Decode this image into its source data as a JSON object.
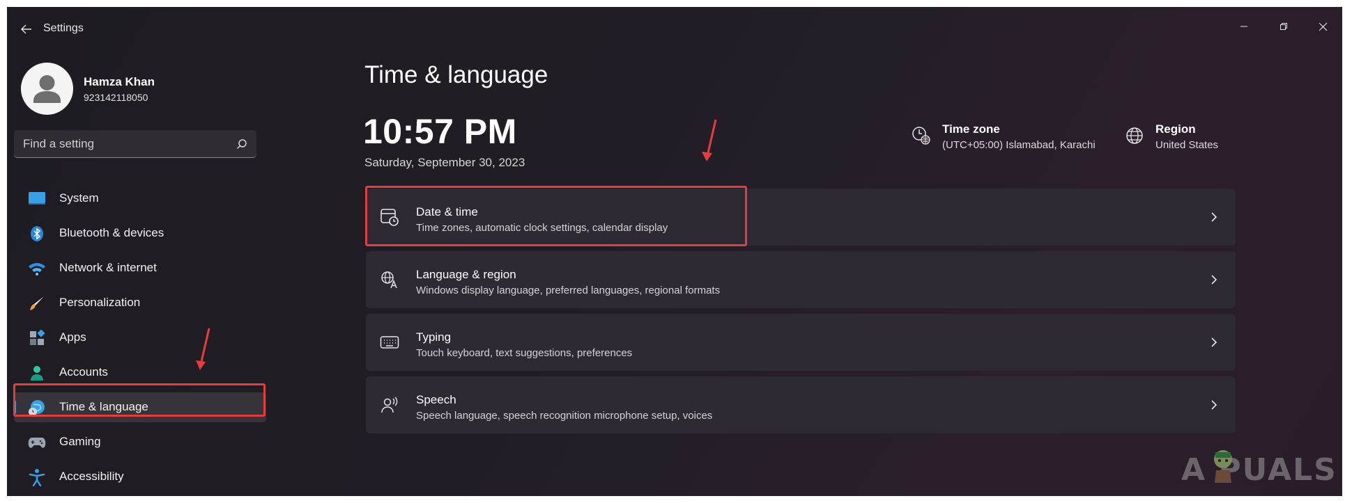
{
  "window": {
    "title": "Settings",
    "controls": {
      "minimize": "minimize-icon",
      "maximize": "restore-icon",
      "close": "close-icon"
    }
  },
  "profile": {
    "name": "Hamza Khan",
    "id": "923142118050"
  },
  "search": {
    "placeholder": "Find a setting",
    "value": ""
  },
  "sidebar": {
    "items": [
      {
        "label": "System",
        "icon": "system-icon",
        "active": false
      },
      {
        "label": "Bluetooth & devices",
        "icon": "bluetooth-icon",
        "active": false
      },
      {
        "label": "Network & internet",
        "icon": "wifi-icon",
        "active": false
      },
      {
        "label": "Personalization",
        "icon": "brush-icon",
        "active": false
      },
      {
        "label": "Apps",
        "icon": "apps-icon",
        "active": false
      },
      {
        "label": "Accounts",
        "icon": "accounts-icon",
        "active": false
      },
      {
        "label": "Time & language",
        "icon": "time-language-icon",
        "active": true
      },
      {
        "label": "Gaming",
        "icon": "gaming-icon",
        "active": false
      },
      {
        "label": "Accessibility",
        "icon": "accessibility-icon",
        "active": false
      }
    ]
  },
  "main": {
    "title": "Time & language",
    "clock": "10:57 PM",
    "date": "Saturday, September 30, 2023",
    "timezone": {
      "title": "Time zone",
      "value": "(UTC+05:00) Islamabad, Karachi"
    },
    "region": {
      "title": "Region",
      "value": "United States"
    },
    "cards": [
      {
        "title": "Date & time",
        "subtitle": "Time zones, automatic clock settings, calendar display",
        "icon": "calendar-clock-icon"
      },
      {
        "title": "Language & region",
        "subtitle": "Windows display language, preferred languages, regional formats",
        "icon": "language-icon"
      },
      {
        "title": "Typing",
        "subtitle": "Touch keyboard, text suggestions, preferences",
        "icon": "keyboard-icon"
      },
      {
        "title": "Speech",
        "subtitle": "Speech language, speech recognition microphone setup, voices",
        "icon": "speech-icon"
      }
    ]
  },
  "watermark": "A  PUALS",
  "colors": {
    "accent": "#4aa3e5",
    "highlight": "#e33e3e",
    "card": "#2e2a33"
  }
}
